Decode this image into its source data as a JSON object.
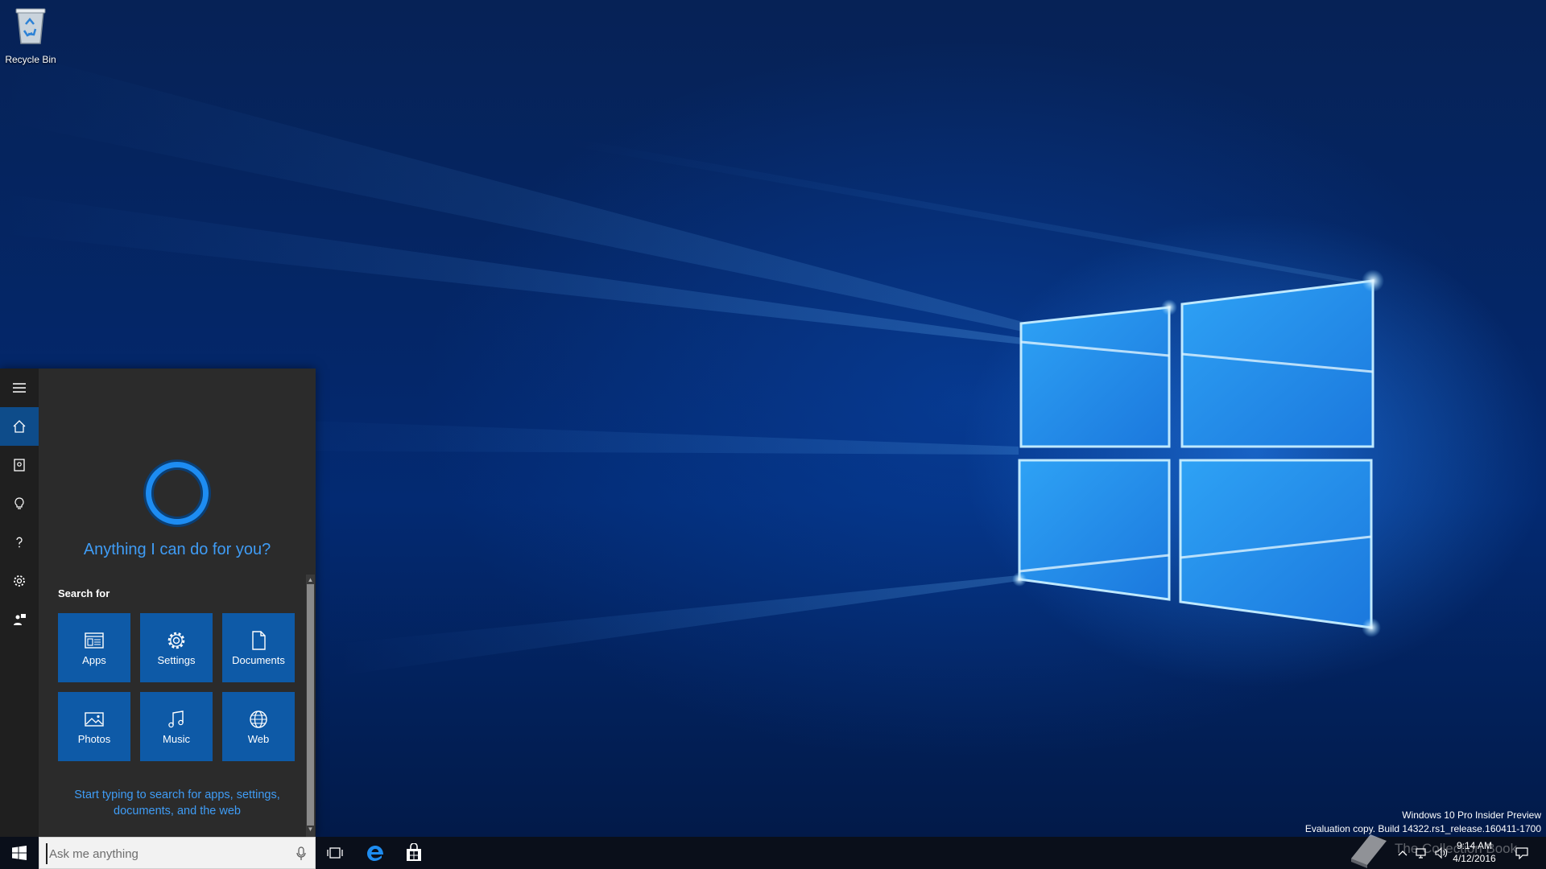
{
  "desktop": {
    "icons": [
      {
        "label": "Recycle Bin",
        "icon": "recycle-bin-icon"
      }
    ],
    "watermark": {
      "line1": "Windows 10 Pro Insider Preview",
      "line2": "Evaluation copy. Build 14322.rs1_release.160411-1700"
    },
    "overlay_brand": "The Collection Book"
  },
  "cortana": {
    "rail": [
      {
        "icon": "hamburger-menu-icon",
        "active": false
      },
      {
        "icon": "home-icon",
        "active": true
      },
      {
        "icon": "notebook-icon",
        "active": false
      },
      {
        "icon": "lightbulb-icon",
        "active": false
      },
      {
        "icon": "help-icon",
        "active": false
      },
      {
        "icon": "gear-icon",
        "active": false
      },
      {
        "icon": "feedback-icon",
        "active": false
      }
    ],
    "greeting": "Anything I can do for you?",
    "search_for_label": "Search for",
    "tiles": [
      {
        "label": "Apps",
        "icon": "apps-icon"
      },
      {
        "label": "Settings",
        "icon": "gear-icon"
      },
      {
        "label": "Documents",
        "icon": "document-icon"
      },
      {
        "label": "Photos",
        "icon": "photo-icon"
      },
      {
        "label": "Music",
        "icon": "music-icon"
      },
      {
        "label": "Web",
        "icon": "globe-icon"
      }
    ],
    "hint_line1": "Start typing to search for apps, settings,",
    "hint_line2": "documents, and the web",
    "accent": "#0e5aa7",
    "text_accent": "#3f9cf5"
  },
  "taskbar": {
    "search_placeholder": "Ask me anything",
    "pinned": [
      "task-view-icon",
      "edge-icon",
      "store-icon"
    ],
    "clock": {
      "time": "9:14 AM",
      "date": "4/12/2016"
    },
    "tray": [
      "chevron-up-icon",
      "network-icon",
      "volume-icon",
      "action-center-icon"
    ]
  }
}
